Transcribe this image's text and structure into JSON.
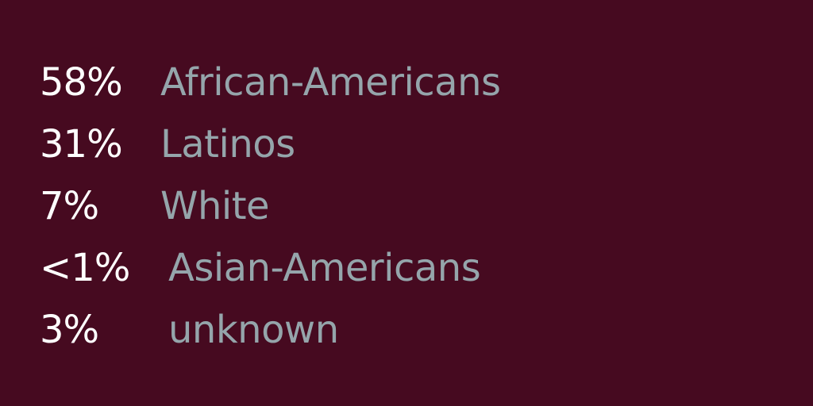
{
  "rows": [
    {
      "percent": "58%",
      "group": "African-Americans"
    },
    {
      "percent": "31%",
      "group": "Latinos"
    },
    {
      "percent": "7%",
      "group": "White"
    },
    {
      "percent": "<1%",
      "group": "Asian-Americans"
    },
    {
      "percent": "3%",
      "group": "unknown"
    }
  ],
  "colors": {
    "background": "#460a20",
    "percent_text": "#ffffff",
    "label_text": "#95a5ab"
  }
}
